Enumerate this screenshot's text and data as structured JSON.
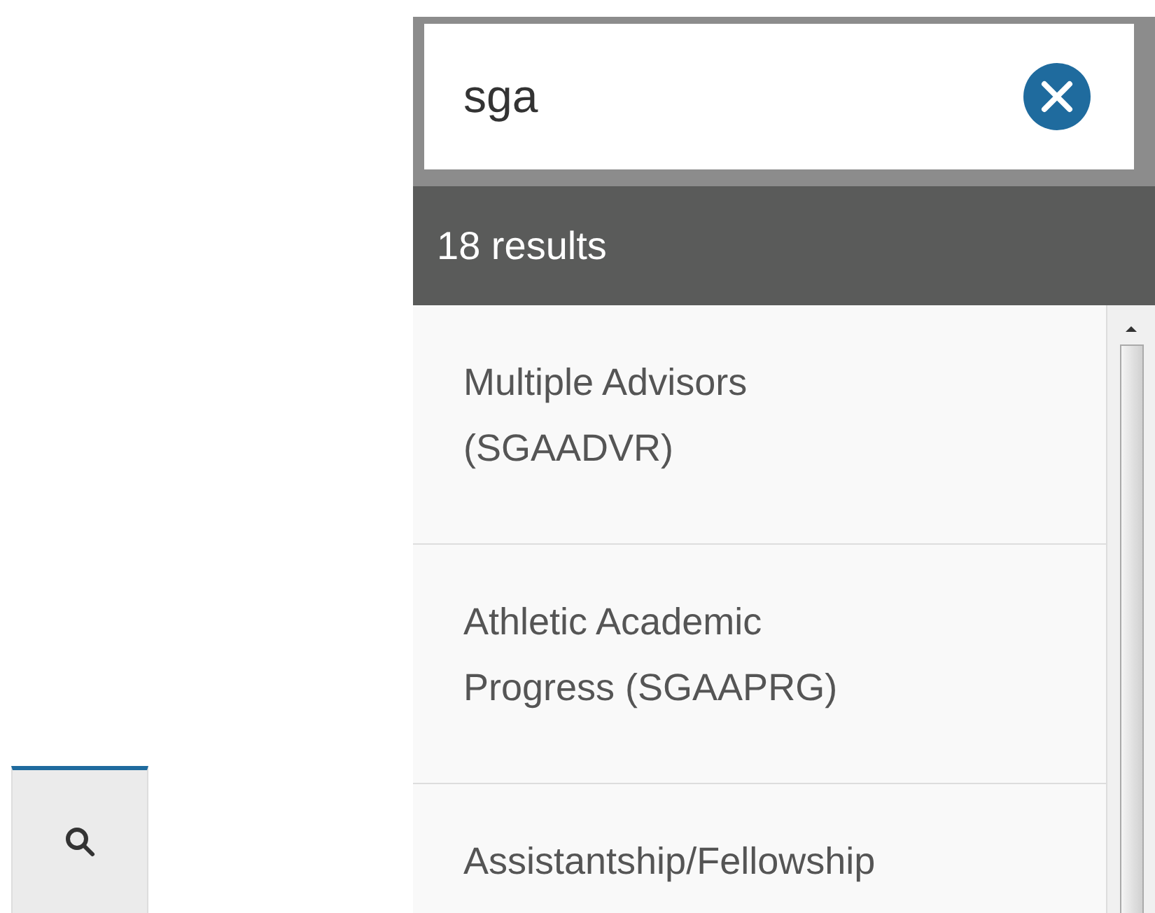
{
  "search_button": {
    "active": true
  },
  "search": {
    "value": "sga"
  },
  "results_count": "18 results",
  "results": [
    {
      "label": "Multiple Advisors (SGAADVR)"
    },
    {
      "label": "Athletic Academic Progress (SGAAPRG)"
    },
    {
      "label": "Assistantship/Fellowship"
    }
  ]
}
